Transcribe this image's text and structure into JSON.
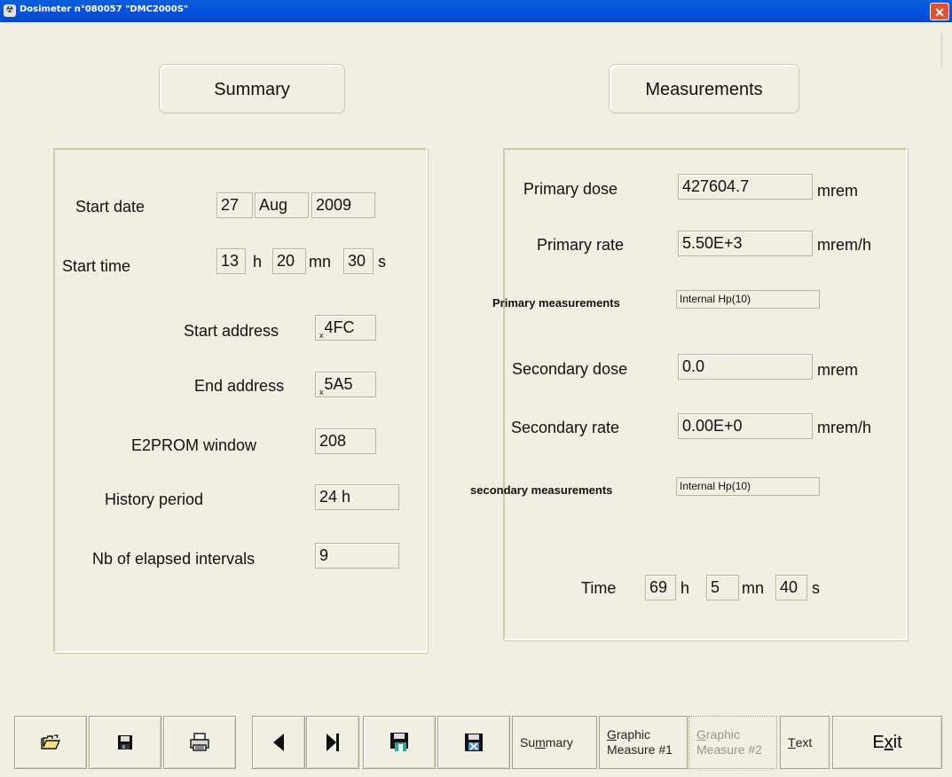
{
  "window": {
    "title": "Dosimeter  n°080057 \"DMC2000S\"",
    "close_glyph": "✕"
  },
  "summary": {
    "heading": "Summary",
    "start_date": {
      "label": "Start date",
      "day": "27",
      "month": "Aug",
      "year": "2009"
    },
    "start_time": {
      "label": "Start time",
      "hours": "13",
      "h_unit": "h",
      "minutes": "20",
      "mn_unit": "mn",
      "seconds": "30",
      "s_unit": "s"
    },
    "start_address": {
      "label": "Start address",
      "prefix": "x",
      "value": "4FC"
    },
    "end_address": {
      "label": "End address",
      "prefix": "x",
      "value": "5A5"
    },
    "e2prom_window": {
      "label": "E2PROM window",
      "value": "208"
    },
    "history_period": {
      "label": "History period",
      "value": "24 h"
    },
    "elapsed_intervals": {
      "label": "Nb of elapsed intervals",
      "value": "9"
    }
  },
  "measurements": {
    "heading": "Measurements",
    "primary_dose": {
      "label": "Primary dose",
      "value": "427604.7",
      "unit": "mrem"
    },
    "primary_rate": {
      "label": "Primary rate",
      "value": "5.50E+3",
      "unit": "mrem/h"
    },
    "primary_measurements": {
      "label": "Primary measurements",
      "value": "Internal Hp(10)"
    },
    "secondary_dose": {
      "label": "Secondary dose",
      "value": "0.0",
      "unit": "mrem"
    },
    "secondary_rate": {
      "label": "Secondary rate",
      "value": "0.00E+0",
      "unit": "mrem/h"
    },
    "secondary_measurements": {
      "label": "secondary measurements",
      "value": "Internal Hp(10)"
    },
    "time": {
      "label": "Time",
      "hours": "69",
      "h_unit": "h",
      "minutes": "5",
      "mn_unit": "mn",
      "seconds": "40",
      "s_unit": "s"
    }
  },
  "toolbar": {
    "icons": [
      "open-folder-icon",
      "save-disk-icon",
      "printer-icon",
      "previous-arrow-icon",
      "last-arrow-icon",
      "save-history-icon",
      "save-export-icon"
    ],
    "summary_tab": {
      "pre": "Su",
      "ul": "m",
      "post": "mary"
    },
    "graphic1_tab": {
      "ul": "G",
      "line1_rest": "raphic",
      "line2": "Measure #1"
    },
    "graphic2_tab": {
      "ul": "G",
      "line1_rest": "raphic",
      "line2": "Measure #2"
    },
    "text_tab": {
      "ul": "T",
      "rest": "ext"
    },
    "exit": {
      "pre": "E",
      "ul": "x",
      "post": "it"
    }
  },
  "colors": {
    "background": "#f0efe2",
    "titlebar": "#0655e4",
    "close": "#e3522f",
    "panel_border": "#cfc9a8",
    "save_icon_accent": "#2aa8a0"
  }
}
